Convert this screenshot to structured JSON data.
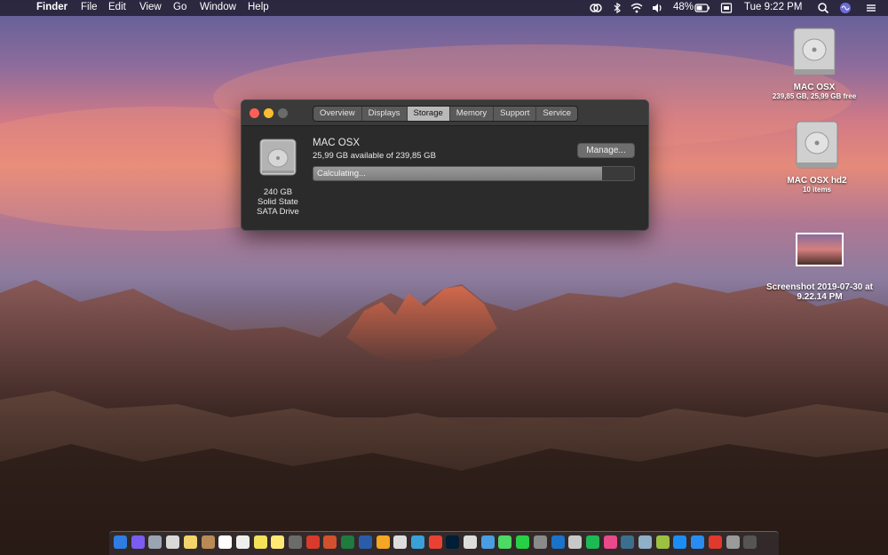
{
  "menubar": {
    "apple": "",
    "app_name": "Finder",
    "menus": [
      "File",
      "Edit",
      "View",
      "Go",
      "Window",
      "Help"
    ],
    "battery": "48%",
    "clock": "Tue 9:22 PM"
  },
  "window": {
    "tabs": [
      "Overview",
      "Displays",
      "Storage",
      "Memory",
      "Support",
      "Service"
    ],
    "selected_tab": "Storage",
    "drive_capacity": "240 GB",
    "drive_type_line1": "Solid State",
    "drive_type_line2": "SATA Drive",
    "volume_name": "MAC OSX",
    "available_text": "25,99 GB available of 239,85 GB",
    "manage_label": "Manage...",
    "progress_label": "Calculating...",
    "progress_fraction": 0.9
  },
  "desktop_icons": [
    {
      "name": "MAC OSX",
      "sub": "239,85 GB, 25,99 GB free"
    },
    {
      "name": "MAC OSX hd2",
      "sub": "10 items"
    },
    {
      "name": "Screenshot 2019-07-30 at",
      "name2": "9.22.14 PM"
    }
  ],
  "dock": {
    "items": [
      "finder",
      "siri",
      "launchpad",
      "preview",
      "notes",
      "contacts",
      "calendar",
      "textedit",
      "stickies",
      "notes-2",
      "scripts",
      "acrobat",
      "powerpoint",
      "excel",
      "word",
      "pages",
      "textedit-2",
      "outlook-cx",
      "chrome",
      "photoshop",
      "cursor",
      "xcode",
      "messages",
      "whatsapp",
      "vpn",
      "edge",
      "disk",
      "spotify",
      "itunes",
      "compressor",
      "migration",
      "android",
      "appstore",
      "safari",
      "anydesk",
      "settings",
      "trash"
    ],
    "colors": [
      "#2f7de1",
      "#7b5cf0",
      "#9aa5b4",
      "#d8d8d8",
      "#f3d36b",
      "#b98a55",
      "#ffffff",
      "#eeeeee",
      "#f5e05a",
      "#ffe873",
      "#6b6b6b",
      "#d83a2b",
      "#d2502d",
      "#1f7a3d",
      "#2b5ca8",
      "#f5a623",
      "#dddddd",
      "#3aa0d8",
      "#e94235",
      "#001e36",
      "#dddddd",
      "#4a9de0",
      "#4cd964",
      "#27d045",
      "#8a8a8a",
      "#1a73c8",
      "#c8c8c8",
      "#1db954",
      "#e84a8a",
      "#3c6e8f",
      "#8fb0c8",
      "#9bc142",
      "#1c8ef3",
      "#2a8cf0",
      "#e0392e",
      "#9a9a9a",
      "#555555"
    ]
  }
}
